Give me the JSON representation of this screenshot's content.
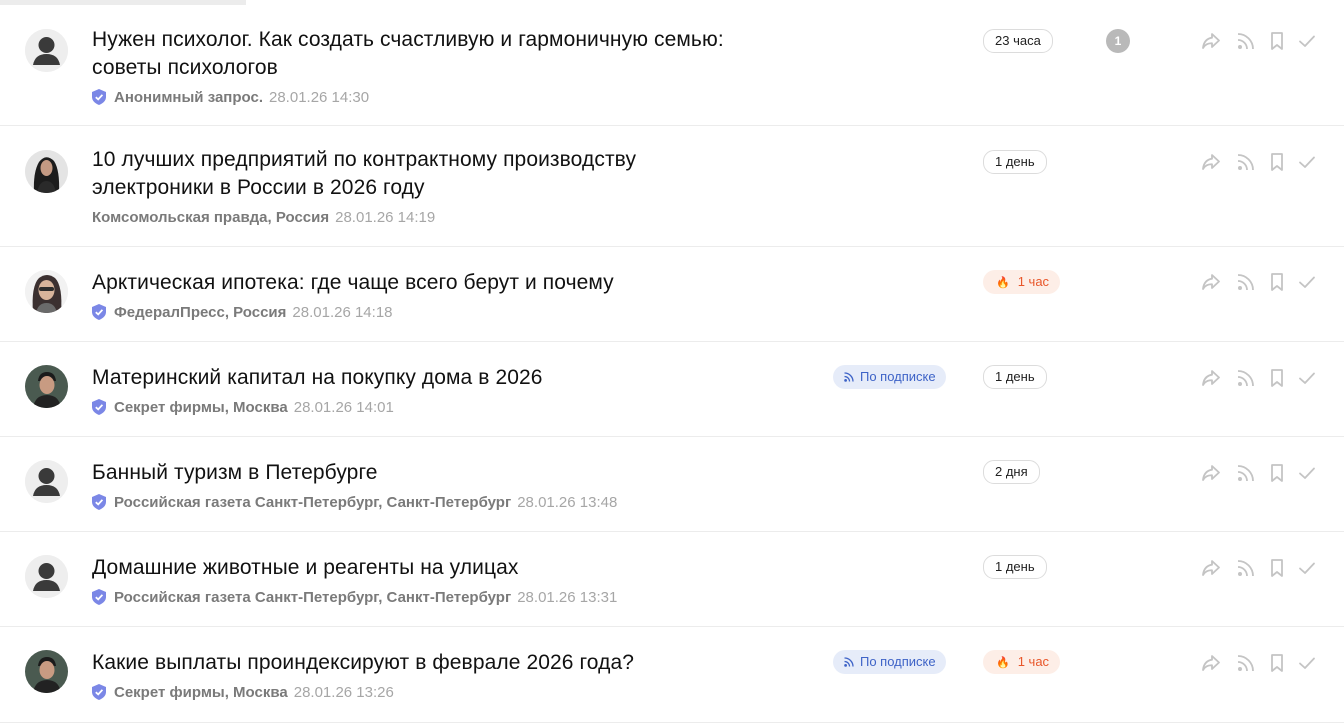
{
  "colors": {
    "verified": "#7b87e6",
    "hot_text": "#e8562a",
    "hot_bg": "#fdeee7",
    "sub_text": "#3e63c7",
    "sub_bg": "#e6ecf9",
    "icon_gray": "#c4c4c4"
  },
  "items": [
    {
      "title": "Нужен психолог. Как создать счастливую и гармоничную семью: советы психологов",
      "title_line1": "Нужен психолог. Как создать счастливую и гармоничную семью:",
      "title_line2": "советы психологов",
      "source": "Анонимный запрос.",
      "datetime": "28.01.26 14:30",
      "verified": true,
      "avatar": "person-silhouette-icon",
      "age": "23 часа",
      "counter": "1"
    },
    {
      "title_line1": "10 лучших предприятий по контрактному производству",
      "title_line2": "электроники в России в 2026 году",
      "source": "Комсомольская правда, Россия",
      "datetime": "28.01.26 14:19",
      "verified": false,
      "avatar": "woman-photo",
      "age": "1 день"
    },
    {
      "title_line1": "Арктическая ипотека: где чаще всего берут и почему",
      "source": "ФедералПресс, Россия",
      "datetime": "28.01.26 14:18",
      "verified": true,
      "avatar": "ai-woman-photo",
      "age": "1 час",
      "hot": true
    },
    {
      "title_line1": "Материнский капитал на покупку дома в 2026",
      "source": "Секрет фирмы, Москва",
      "datetime": "28.01.26 14:01",
      "verified": true,
      "avatar": "man-photo",
      "age": "1 день",
      "subscription": "По подписке"
    },
    {
      "title_line1": "Банный туризм в Петербурге",
      "source": "Российская газета Санкт-Петербург, Санкт-Петербург",
      "datetime": "28.01.26 13:48",
      "verified": true,
      "avatar": "person-silhouette-icon",
      "age": "2 дня"
    },
    {
      "title_line1": "Домашние животные и реагенты на улицах",
      "source": "Российская газета Санкт-Петербург, Санкт-Петербург",
      "datetime": "28.01.26 13:31",
      "verified": true,
      "avatar": "person-silhouette-icon",
      "age": "1 день"
    },
    {
      "title_line1": "Какие выплаты проиндексируют в феврале 2026 года?",
      "source": "Секрет фирмы, Москва",
      "datetime": "28.01.26 13:26",
      "verified": true,
      "avatar": "man-photo",
      "age": "1 час",
      "hot": true,
      "subscription": "По подписке"
    }
  ],
  "actions": [
    "share-icon",
    "rss-icon",
    "bookmark-icon",
    "check-icon"
  ]
}
